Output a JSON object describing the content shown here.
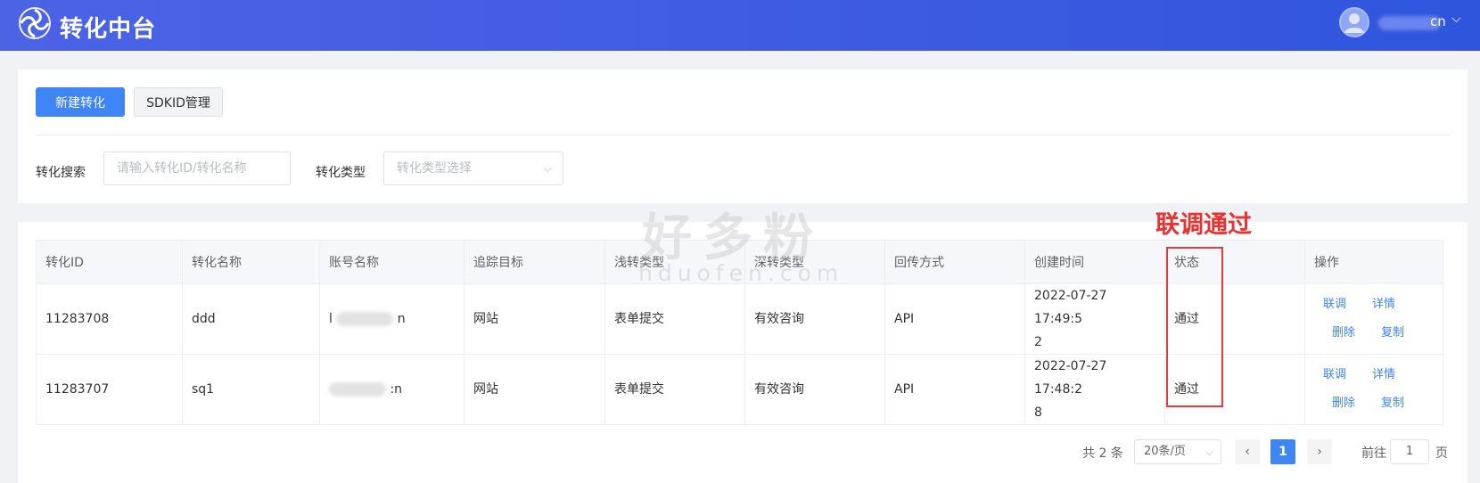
{
  "header": {
    "title": "转化中台",
    "user_suffix": "cn"
  },
  "toolbar": {
    "new_button": "新建转化",
    "sdkid_button": "SDKID管理"
  },
  "filters": {
    "search_label": "转化搜索",
    "search_placeholder": "请输入转化ID/转化名称",
    "type_label": "转化类型",
    "type_placeholder": "转化类型选择"
  },
  "table": {
    "columns": [
      "转化ID",
      "转化名称",
      "账号名称",
      "追踪目标",
      "浅转类型",
      "深转类型",
      "回传方式",
      "创建时间",
      "状态",
      "操作"
    ],
    "rows": [
      {
        "id": "11283708",
        "name": "ddd",
        "account_prefix": "l",
        "account_suffix": "n",
        "target": "网站",
        "shallow": "表单提交",
        "deep": "有效咨询",
        "method": "API",
        "created_line1": "2022-07-27 17:49:5",
        "created_line2": "2",
        "status": "通过"
      },
      {
        "id": "11283707",
        "name": "sq1",
        "account_prefix": "",
        "account_suffix": ":n",
        "target": "网站",
        "shallow": "表单提交",
        "deep": "有效咨询",
        "method": "API",
        "created_line1": "2022-07-27 17:48:2",
        "created_line2": "8",
        "status": "通过"
      }
    ],
    "ops": [
      "联调",
      "详情",
      "删除",
      "复制"
    ]
  },
  "pagination": {
    "total": "共 2 条",
    "page_size": "20条/页",
    "current_page": "1",
    "goto_prefix": "前往",
    "goto_value": "1",
    "goto_suffix": "页"
  },
  "annotation": {
    "text": "联调通过"
  },
  "watermark": {
    "main": "好多粉",
    "sub": "hduofen.com"
  },
  "colors": {
    "header_gradient_start": "#4c63e6",
    "header_gradient_end": "#2f55dd",
    "primary": "#3e85f5",
    "annotation_red": "#e23c3c"
  }
}
